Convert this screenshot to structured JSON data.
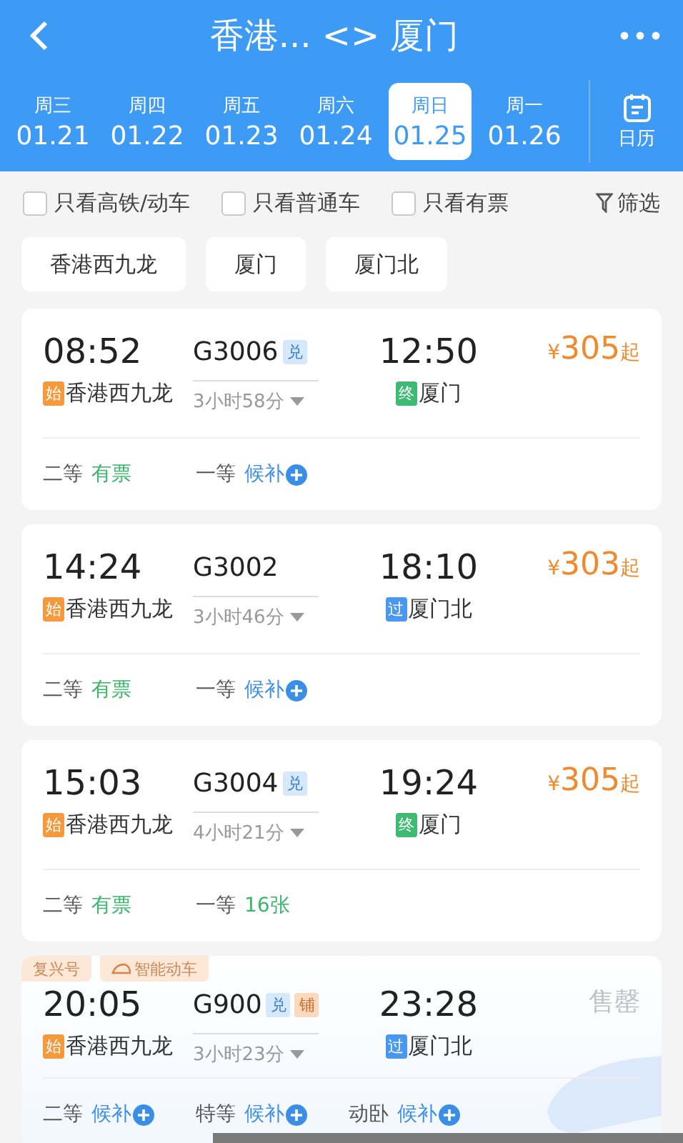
{
  "header": {
    "title": "香港... <> 厦门",
    "calendar_label": "日历"
  },
  "dates": [
    {
      "weekday": "周三",
      "date": "01.21",
      "selected": false
    },
    {
      "weekday": "周四",
      "date": "01.22",
      "selected": false
    },
    {
      "weekday": "周五",
      "date": "01.23",
      "selected": false
    },
    {
      "weekday": "周六",
      "date": "01.24",
      "selected": false
    },
    {
      "weekday": "周日",
      "date": "01.25",
      "selected": true
    },
    {
      "weekday": "周一",
      "date": "01.26",
      "selected": false
    }
  ],
  "filters": [
    {
      "label": "只看高铁/动车",
      "checked": false
    },
    {
      "label": "只看普通车",
      "checked": false
    },
    {
      "label": "只看有票",
      "checked": false
    }
  ],
  "filter_button": "筛选",
  "stations": [
    "香港西九龙",
    "厦门",
    "厦门北"
  ],
  "trains": [
    {
      "depart": "08:52",
      "train_no": "G3006",
      "badges": [
        {
          "kind": "exchange",
          "text": "兑"
        }
      ],
      "duration": "3小时58分",
      "arrive": "12:50",
      "from_tag": {
        "kind": "start",
        "text": "始"
      },
      "from": "香港西九龙",
      "to_tag": {
        "kind": "end",
        "text": "终"
      },
      "to": "厦门",
      "price": {
        "kind": "price",
        "symbol": "¥",
        "amount": "305",
        "suffix": "起"
      },
      "seats": [
        {
          "class": "二等",
          "status": "有票",
          "kind": "available"
        },
        {
          "class": "一等",
          "status": "候补",
          "kind": "waitlist"
        }
      ]
    },
    {
      "depart": "14:24",
      "train_no": "G3002",
      "duration": "3小时46分",
      "arrive": "18:10",
      "from_tag": {
        "kind": "start",
        "text": "始"
      },
      "from": "香港西九龙",
      "to_tag": {
        "kind": "pass",
        "text": "过"
      },
      "to": "厦门北",
      "price": {
        "kind": "price",
        "symbol": "¥",
        "amount": "303",
        "suffix": "起"
      },
      "seats": [
        {
          "class": "二等",
          "status": "有票",
          "kind": "available"
        },
        {
          "class": "一等",
          "status": "候补",
          "kind": "waitlist"
        }
      ]
    },
    {
      "depart": "15:03",
      "train_no": "G3004",
      "badges": [
        {
          "kind": "exchange",
          "text": "兑"
        }
      ],
      "duration": "4小时21分",
      "arrive": "19:24",
      "from_tag": {
        "kind": "start",
        "text": "始"
      },
      "from": "香港西九龙",
      "to_tag": {
        "kind": "end",
        "text": "终"
      },
      "to": "厦门",
      "price": {
        "kind": "price",
        "symbol": "¥",
        "amount": "305",
        "suffix": "起"
      },
      "seats": [
        {
          "class": "二等",
          "status": "有票",
          "kind": "available"
        },
        {
          "class": "一等",
          "status": "16张",
          "kind": "available"
        }
      ]
    },
    {
      "tags": [
        {
          "kind": "plain",
          "text": "复兴号"
        },
        {
          "kind": "smart",
          "text": "智能动车"
        }
      ],
      "depart": "20:05",
      "train_no": "G900",
      "badges": [
        {
          "kind": "exchange",
          "text": "兑"
        },
        {
          "kind": "sleeper",
          "text": "铺"
        }
      ],
      "duration": "3小时23分",
      "arrive": "23:28",
      "from_tag": {
        "kind": "start",
        "text": "始"
      },
      "from": "香港西九龙",
      "to_tag": {
        "kind": "pass",
        "text": "过"
      },
      "to": "厦门北",
      "price": {
        "kind": "sold_out",
        "text": "售罄"
      },
      "seats": [
        {
          "class": "二等",
          "status": "候补",
          "kind": "waitlist"
        },
        {
          "class": "特等",
          "status": "候补",
          "kind": "waitlist"
        },
        {
          "class": "动卧",
          "status": "候补",
          "kind": "waitlist"
        }
      ]
    }
  ]
}
